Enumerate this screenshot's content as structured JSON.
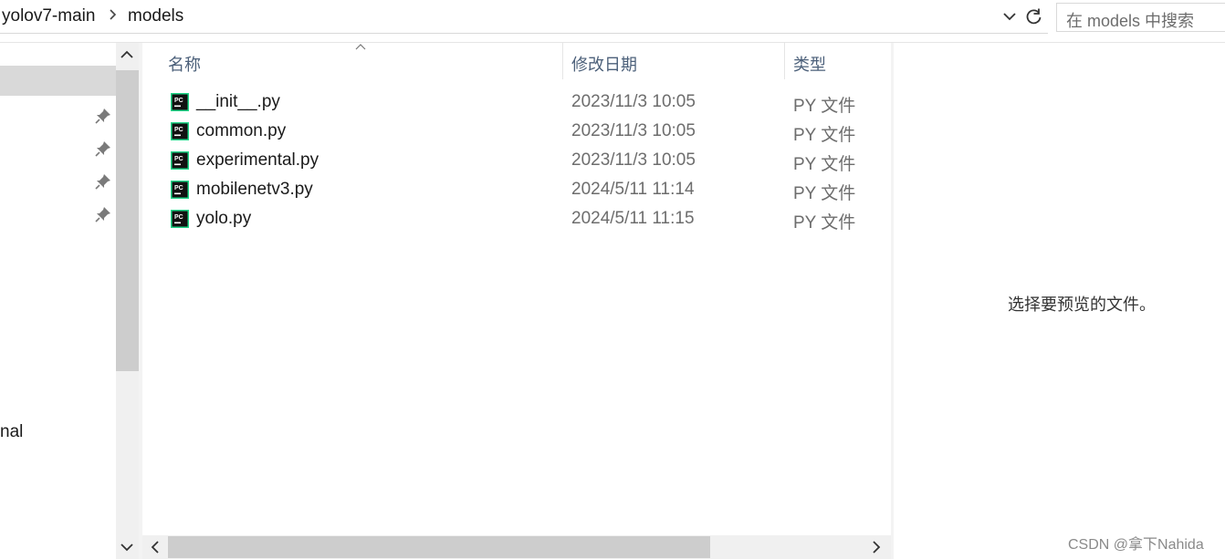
{
  "address_bar": {
    "crumbs": [
      "yolov7-main",
      "models"
    ],
    "separator_icon": "chevron-right-icon",
    "dropdown_icon": "chevron-down-icon",
    "refresh_icon": "refresh-icon"
  },
  "search": {
    "placeholder": "在 models 中搜索"
  },
  "nav": {
    "pin_icon": "pin-icon",
    "partial_item_label": "nal"
  },
  "columns": {
    "name": "名称",
    "date": "修改日期",
    "type": "类型"
  },
  "files": [
    {
      "name": "__init__.py",
      "date": "2023/11/3 10:05",
      "type": "PY 文件",
      "icon": "pycharm-file-icon"
    },
    {
      "name": "common.py",
      "date": "2023/11/3 10:05",
      "type": "PY 文件",
      "icon": "pycharm-file-icon"
    },
    {
      "name": "experimental.py",
      "date": "2023/11/3 10:05",
      "type": "PY 文件",
      "icon": "pycharm-file-icon"
    },
    {
      "name": "mobilenetv3.py",
      "date": "2024/5/11 11:14",
      "type": "PY 文件",
      "icon": "pycharm-file-icon"
    },
    {
      "name": "yolo.py",
      "date": "2024/5/11 11:15",
      "type": "PY 文件",
      "icon": "pycharm-file-icon"
    }
  ],
  "preview": {
    "message": "选择要预览的文件。"
  },
  "watermark": "CSDN @拿下Nahida",
  "colors": {
    "header_text": "#4c607a",
    "selection": "#d9d9d9",
    "scrollbar_thumb": "#cdcdcd",
    "pycharm_green": "#21d789"
  }
}
